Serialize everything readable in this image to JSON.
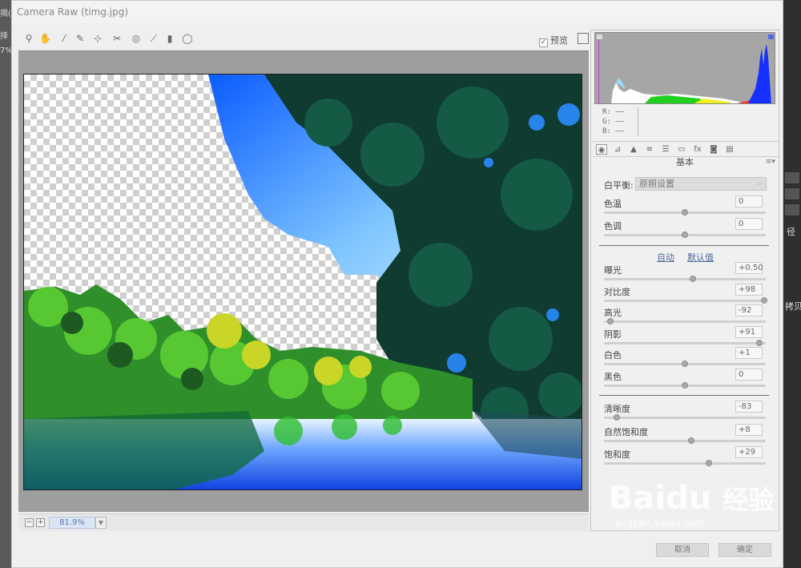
{
  "window": {
    "title": "Camera Raw (timg.jpg)"
  },
  "background_app": {
    "left_labels": [
      "揭(E",
      "择",
      "7%"
    ],
    "right_labels": [
      "径",
      "拷贝"
    ]
  },
  "toolbar": {
    "tools": [
      "zoom-icon",
      "hand-icon",
      "white-balance-icon",
      "color-sampler-icon",
      "target-adjust-icon",
      "crop-icon",
      "straighten-icon",
      "spot-removal-icon",
      "red-eye-icon",
      "adjustment-brush-icon",
      "graduated-filter-icon",
      "radial-filter-icon"
    ],
    "preview_label": "预览",
    "preview_checked": true
  },
  "zoom": {
    "value": "81.9%",
    "minus": "−",
    "plus": "+"
  },
  "histogram": {
    "r_label": "R:",
    "g_label": "G:",
    "b_label": "B:",
    "r_value": "——",
    "g_value": "——",
    "b_value": "——"
  },
  "panel": {
    "section_title": "基本",
    "white_balance_label": "白平衡:",
    "white_balance_value": "原照设置",
    "auto_label": "自动",
    "default_label": "默认值",
    "sliders_wb": [
      {
        "label": "色温",
        "value": "0",
        "pos": 0.5
      },
      {
        "label": "色调",
        "value": "0",
        "pos": 0.5
      }
    ],
    "sliders_tone": [
      {
        "label": "曝光",
        "value": "+0.50",
        "pos": 0.55
      },
      {
        "label": "对比度",
        "value": "+98",
        "pos": 0.99
      },
      {
        "label": "高光",
        "value": "-92",
        "pos": 0.04
      },
      {
        "label": "阴影",
        "value": "+91",
        "pos": 0.96
      },
      {
        "label": "白色",
        "value": "+1",
        "pos": 0.5
      },
      {
        "label": "黑色",
        "value": "0",
        "pos": 0.5
      }
    ],
    "sliders_presence": [
      {
        "label": "清晰度",
        "value": "-83",
        "pos": 0.08
      },
      {
        "label": "自然饱和度",
        "value": "+8",
        "pos": 0.54
      },
      {
        "label": "饱和度",
        "value": "+29",
        "pos": 0.65
      }
    ]
  },
  "footer": {
    "cancel_label": "取消",
    "ok_label": "确定"
  },
  "watermark": {
    "brand": "Bai",
    "cn": "经验",
    "url": "jingyan.baidu.com"
  },
  "colors": {
    "accent": "#4c6a9a",
    "panel_bg": "#f0f0f0",
    "canvas_bg": "#9e9e9e"
  }
}
